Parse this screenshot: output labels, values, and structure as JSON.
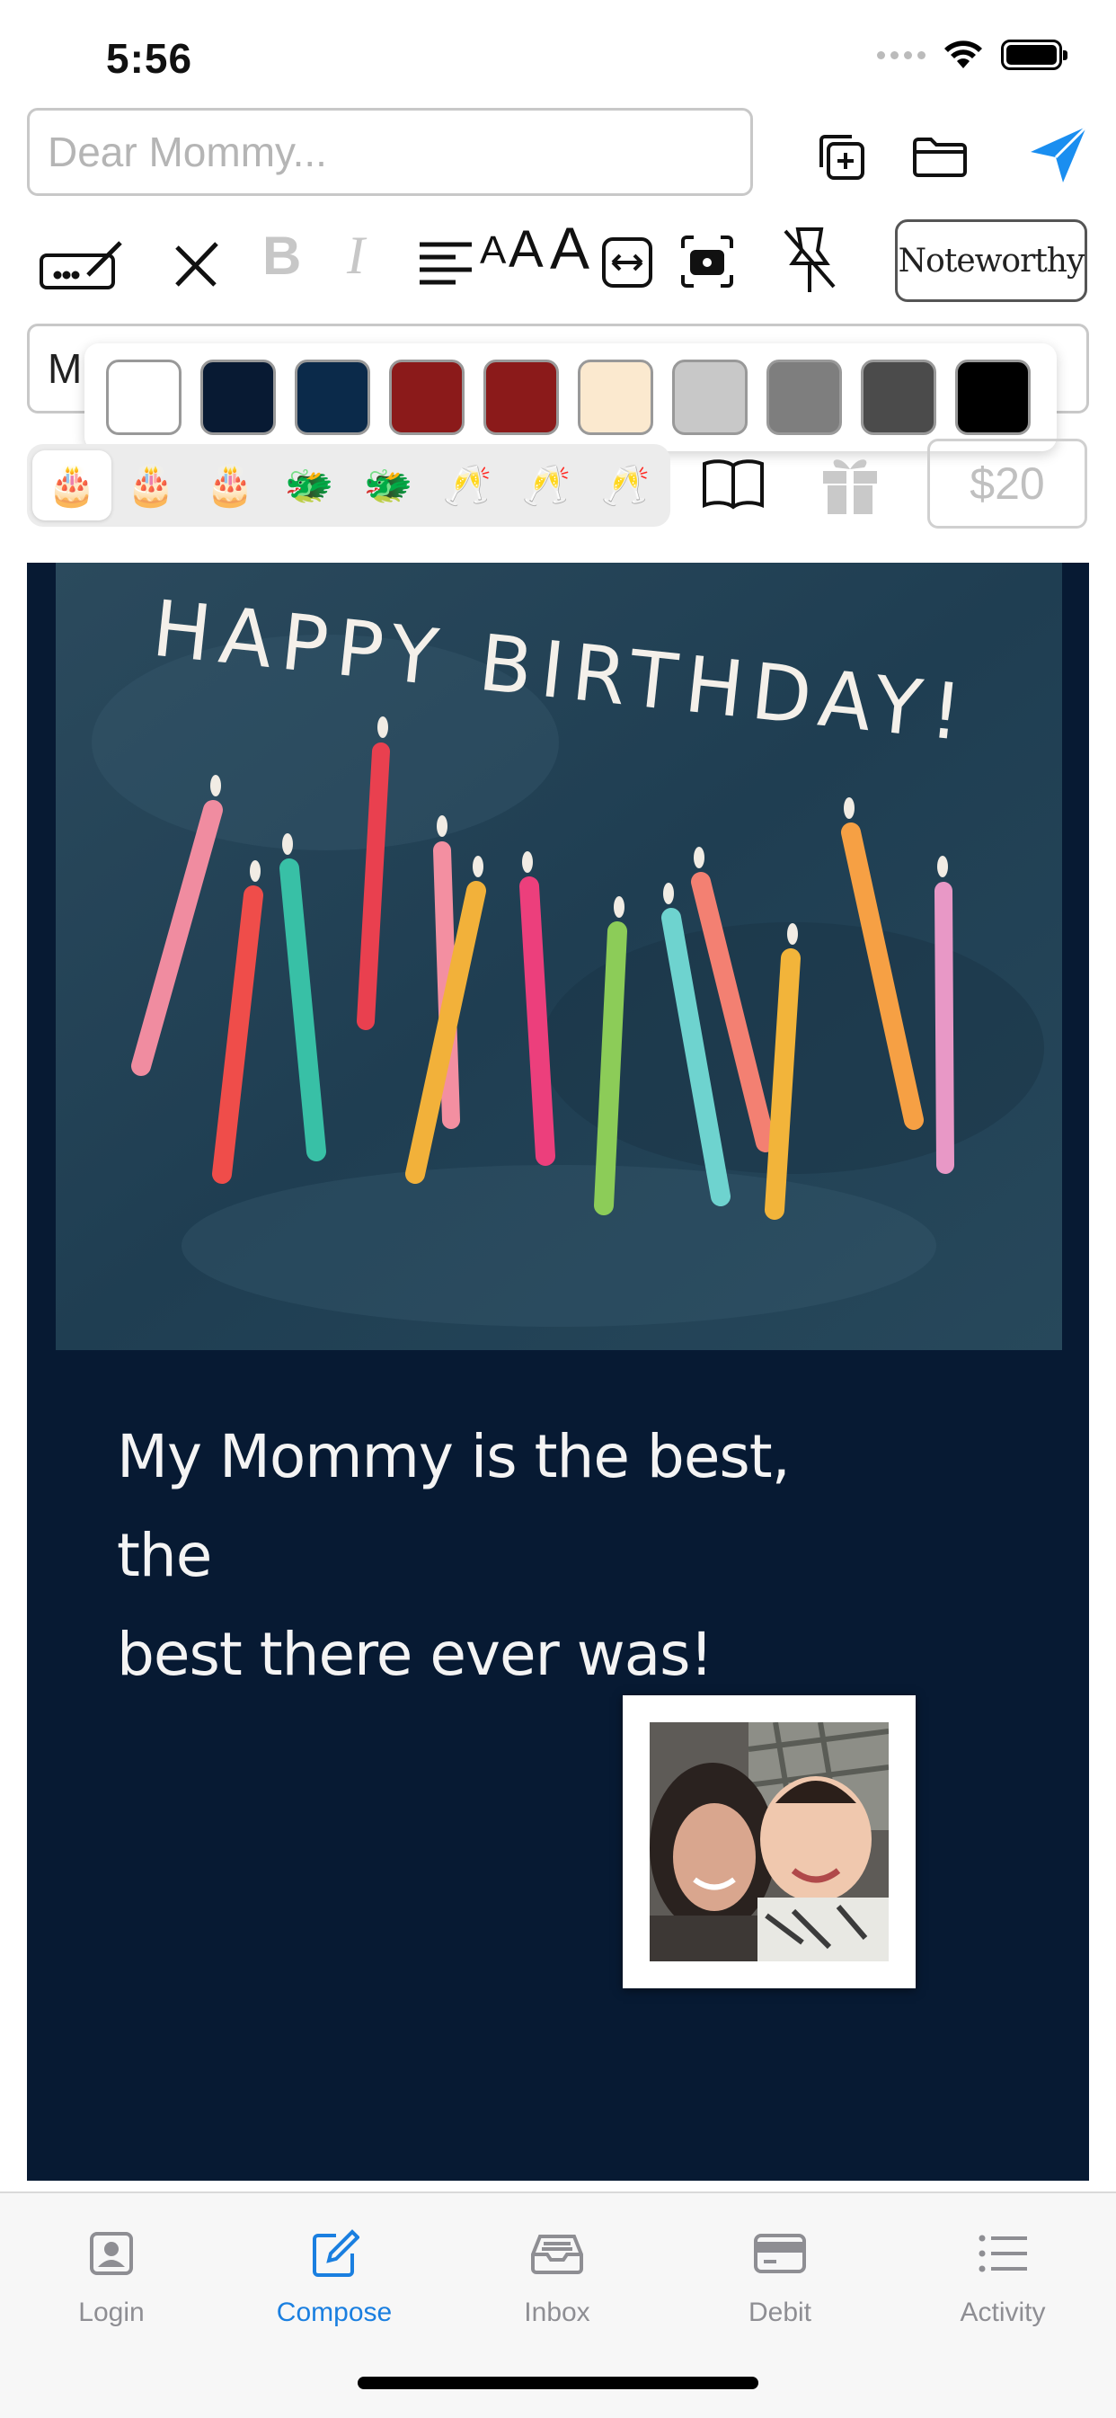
{
  "status_bar": {
    "time": "5:56"
  },
  "compose": {
    "to_placeholder": "Dear Mommy...",
    "subject_value": "M",
    "font_button": "Noteworthy",
    "amount_placeholder": "$20"
  },
  "palette": {
    "swatches": [
      "#ffffff",
      "#081a33",
      "#0b2a4a",
      "#8b1a1a",
      "#8b1a1a",
      "#fbe9cf",
      "#c8c8c8",
      "#7e7e7e",
      "#4b4b4b",
      "#000000"
    ]
  },
  "stickers": {
    "items": [
      "🎂",
      "🎂",
      "🎂",
      "🐲",
      "🐲",
      "🥂",
      "🥂",
      "🥂"
    ],
    "selected_index": 0
  },
  "card": {
    "art_title": "HAPPY BIRTHDAY!",
    "message_line1": "My Mommy is the best, the",
    "message_line2": "best there ever was!",
    "background": "#071a33"
  },
  "tabbar": {
    "tabs": [
      {
        "label": "Login",
        "icon": "person-badge-icon"
      },
      {
        "label": "Compose",
        "icon": "compose-icon"
      },
      {
        "label": "Inbox",
        "icon": "tray-icon"
      },
      {
        "label": "Debit",
        "icon": "credit-card-icon"
      },
      {
        "label": "Activity",
        "icon": "list-icon"
      }
    ],
    "active_index": 1
  },
  "colors": {
    "accent": "#1a7fe0",
    "inactive": "#8e8e93"
  }
}
